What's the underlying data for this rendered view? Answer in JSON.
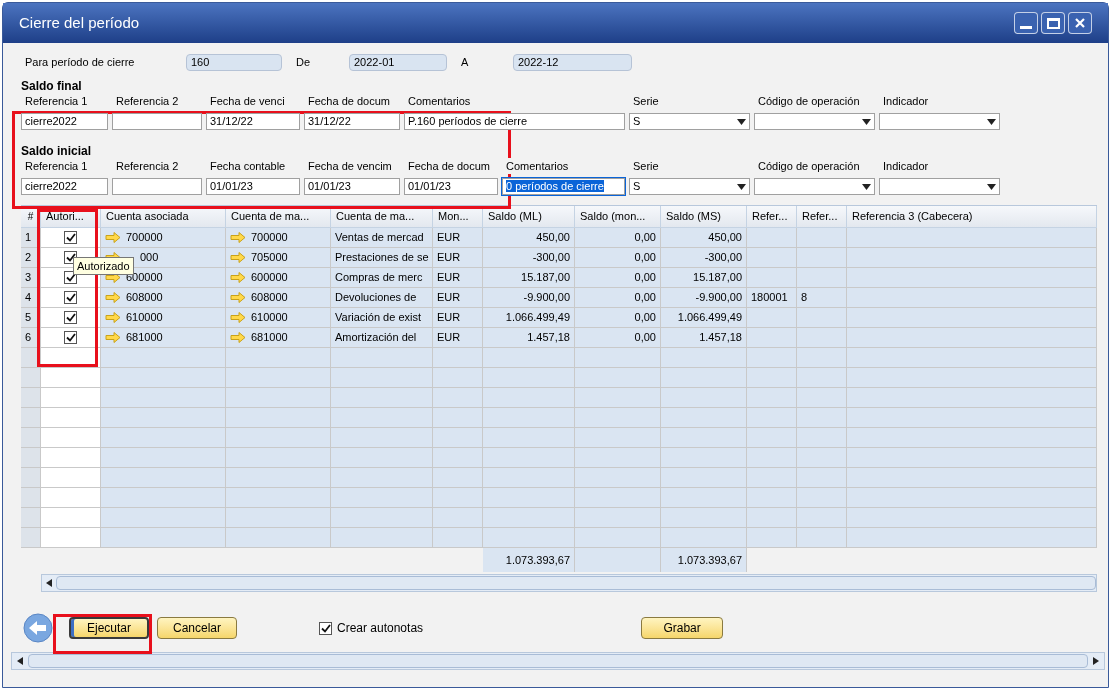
{
  "window": {
    "title": "Cierre del período"
  },
  "period": [
    {
      "label": "Para período de cierre",
      "value": "160"
    },
    {
      "label": "De",
      "value": "2022-01"
    },
    {
      "label": "A",
      "value": "2022-12"
    }
  ],
  "saldo_final": {
    "heading": "Saldo final",
    "fields": [
      {
        "label": "Referencia 1",
        "value": "cierre2022",
        "kind": "text",
        "highlighted": false
      },
      {
        "label": "Referencia 2",
        "kind": "text",
        "highlighted": false
      },
      {
        "label": "Fecha de venci",
        "value": "31/12/22",
        "kind": "text",
        "highlighted": false
      },
      {
        "label": "Fecha de docum",
        "value": "31/12/22",
        "kind": "text",
        "highlighted": false
      },
      {
        "label": "Comentarios",
        "value": "P.160 períodos de cierre",
        "kind": "text",
        "highlighted": false
      },
      {
        "label": "Serie",
        "value": "S",
        "kind": "dropdown",
        "highlighted": false
      },
      {
        "label": "Código de operación",
        "kind": "dropdown",
        "highlighted": false
      },
      {
        "label": "Indicador",
        "kind": "dropdown",
        "highlighted": false
      }
    ]
  },
  "saldo_inicial": {
    "heading": "Saldo inicial",
    "fields": [
      {
        "label": "Referencia 1",
        "value": "cierre2022",
        "kind": "text",
        "highlighted": false
      },
      {
        "label": "Referencia 2",
        "kind": "text",
        "highlighted": false
      },
      {
        "label": "Fecha contable",
        "value": "01/01/23",
        "kind": "text",
        "highlighted": false
      },
      {
        "label": "Fecha de vencim",
        "value": "01/01/23",
        "kind": "text",
        "highlighted": false
      },
      {
        "label": "Fecha de docum",
        "value": "01/01/23",
        "kind": "text",
        "highlighted": false
      },
      {
        "label": "Comentarios",
        "value": "0 períodos de cierre",
        "kind": "text",
        "highlighted": true
      },
      {
        "label": "Serie",
        "value": "S",
        "kind": "dropdown",
        "highlighted": false
      },
      {
        "label": "Código de operación",
        "kind": "dropdown",
        "highlighted": false
      },
      {
        "label": "Indicador",
        "kind": "dropdown",
        "highlighted": false
      }
    ]
  },
  "table": {
    "columns": [
      "#",
      "Autori...",
      "Cuenta asociada",
      "Cuenta de ma...",
      "Cuenta de ma...",
      "Mon...",
      "Saldo (ML)",
      "Saldo (mon...",
      "Saldo (MS)",
      "Refer...",
      "Refer...",
      "Referencia 3 (Cabecera)"
    ],
    "rows": [
      {
        "number": "1",
        "authorized": true,
        "cuenta_asociada": "700000",
        "cuenta_mayor": "700000",
        "nombre": "Ventas de mercad",
        "moneda": "EUR",
        "saldo_ml": "450,00",
        "saldo_mon": "0,00",
        "saldo_ms": "450,00"
      },
      {
        "number": "2",
        "authorized": true,
        "cuenta_asociada": "000",
        "cuenta_mayor": "705000",
        "nombre": "Prestaciones de se",
        "moneda": "EUR",
        "saldo_ml": "-300,00",
        "saldo_mon": "0,00",
        "saldo_ms": "-300,00"
      },
      {
        "number": "3",
        "authorized": true,
        "cuenta_asociada": "600000",
        "cuenta_mayor": "600000",
        "nombre": "Compras de merc",
        "moneda": "EUR",
        "saldo_ml": "15.187,00",
        "saldo_mon": "0,00",
        "saldo_ms": "15.187,00"
      },
      {
        "number": "4",
        "authorized": true,
        "cuenta_asociada": "608000",
        "cuenta_mayor": "608000",
        "nombre": "Devoluciones de",
        "moneda": "EUR",
        "saldo_ml": "-9.900,00",
        "saldo_mon": "0,00",
        "saldo_ms": "-9.900,00",
        "ref1": "180001",
        "ref2": "8"
      },
      {
        "number": "5",
        "authorized": true,
        "cuenta_asociada": "610000",
        "cuenta_mayor": "610000",
        "nombre": "Variación de exist",
        "moneda": "EUR",
        "saldo_ml": "1.066.499,49",
        "saldo_mon": "0,00",
        "saldo_ms": "1.066.499,49"
      },
      {
        "number": "6",
        "authorized": true,
        "cuenta_asociada": "681000",
        "cuenta_mayor": "681000",
        "nombre": "Amortización del",
        "moneda": "EUR",
        "saldo_ml": "1.457,18",
        "saldo_mon": "0,00",
        "saldo_ms": "1.457,18"
      }
    ],
    "totals": {
      "saldo_ml": "1.073.393,67",
      "saldo_ms": "1.073.393,67"
    }
  },
  "tooltip": {
    "text": "Autorizado"
  },
  "buttons": [
    {
      "label": "Ejecutar",
      "focused": true
    },
    {
      "label": "Cancelar",
      "focused": false
    }
  ],
  "checkbox": {
    "label": "Crear autonotas",
    "checked": true
  },
  "save_button": {
    "label": "Grabar"
  }
}
